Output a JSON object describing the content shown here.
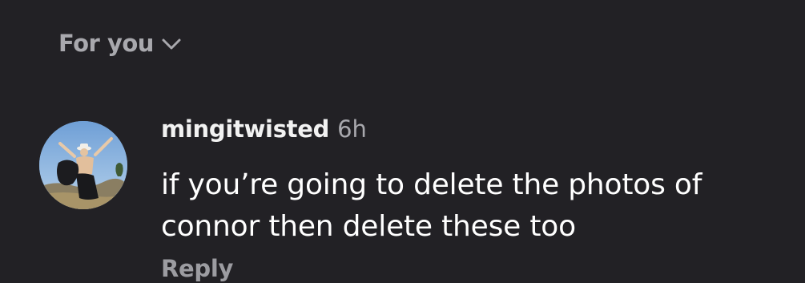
{
  "feed_selector": {
    "label": "For you",
    "icon": "chevron-down-icon"
  },
  "comment": {
    "avatar_icon": "user-avatar",
    "username": "mingitwisted",
    "time": "6h",
    "text_line1": "if you’re going to delete the photos of",
    "text_line2": "connor then delete these too",
    "reply_label": "Reply"
  },
  "colors": {
    "background": "#222125",
    "primary_text": "#ffffff",
    "secondary_text": "#a8a8ad"
  }
}
